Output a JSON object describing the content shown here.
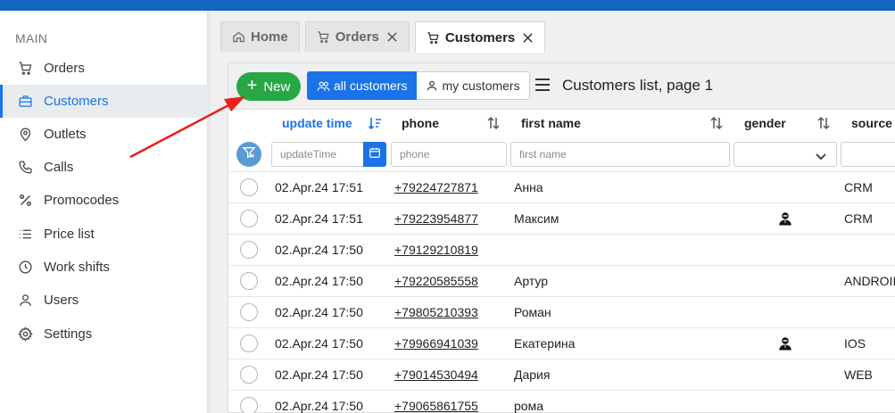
{
  "sidebar": {
    "heading": "MAIN",
    "items": [
      {
        "label": "Orders",
        "icon": "cart-icon",
        "active": false
      },
      {
        "label": "Customers",
        "icon": "briefcase-icon",
        "active": true
      },
      {
        "label": "Outlets",
        "icon": "map-pin-icon",
        "active": false
      },
      {
        "label": "Calls",
        "icon": "phone-icon",
        "active": false
      },
      {
        "label": "Promocodes",
        "icon": "percent-icon",
        "active": false
      },
      {
        "label": "Price list",
        "icon": "list-icon",
        "active": false
      },
      {
        "label": "Work shifts",
        "icon": "clock-icon",
        "active": false
      },
      {
        "label": "Users",
        "icon": "user-icon",
        "active": false
      },
      {
        "label": "Settings",
        "icon": "gear-icon",
        "active": false
      }
    ]
  },
  "tabs": [
    {
      "label": "Home",
      "icon": "home-icon",
      "closable": false
    },
    {
      "label": "Orders",
      "icon": "cart-icon",
      "closable": true
    },
    {
      "label": "Customers",
      "icon": "cart-icon",
      "closable": true,
      "active": true
    }
  ],
  "toolbar": {
    "new_label": "New",
    "filter_all_label": "all customers",
    "filter_my_label": "my customers",
    "title": "Customers list, page 1"
  },
  "columns": {
    "update_time": "update time",
    "phone": "phone",
    "first_name": "first name",
    "gender": "gender",
    "source": "source"
  },
  "filters": {
    "update_time_placeholder": "updateTime",
    "phone_placeholder": "phone",
    "first_name_placeholder": "first name",
    "gender_value": ""
  },
  "rows": [
    {
      "time": "02.Apr.24 17:51",
      "phone": "+79224727871",
      "name": "Анна",
      "gender_icon": false,
      "source": "CRM"
    },
    {
      "time": "02.Apr.24 17:51",
      "phone": "+79223954877",
      "name": "Максим",
      "gender_icon": true,
      "source": "CRM"
    },
    {
      "time": "02.Apr.24 17:50",
      "phone": "+79129210819",
      "name": "",
      "gender_icon": false,
      "source": ""
    },
    {
      "time": "02.Apr.24 17:50",
      "phone": "+79220585558",
      "name": "Артур",
      "gender_icon": false,
      "source": "ANDROII"
    },
    {
      "time": "02.Apr.24 17:50",
      "phone": "+79805210393",
      "name": "Роман",
      "gender_icon": false,
      "source": ""
    },
    {
      "time": "02.Apr.24 17:50",
      "phone": "+79966941039",
      "name": "Екатерина",
      "gender_icon": true,
      "source": "IOS"
    },
    {
      "time": "02.Apr.24 17:50",
      "phone": "+79014530494",
      "name": "Дария",
      "gender_icon": false,
      "source": "WEB"
    },
    {
      "time": "02.Apr.24 17:50",
      "phone": "+79065861755",
      "name": "рома",
      "gender_icon": false,
      "source": ""
    }
  ],
  "colors": {
    "accent": "#1a73e8",
    "new_button": "#28a745",
    "annotation_arrow": "#e8201a",
    "topbar": "#1565c0"
  }
}
